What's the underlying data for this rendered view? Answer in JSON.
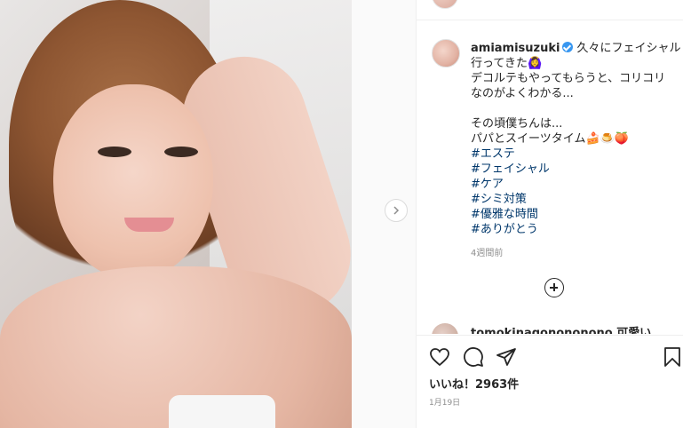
{
  "post": {
    "username": "amiamisuzuki",
    "caption_lines": [
      "久々にフェイシャル",
      "行ってきた🙆‍♀️",
      "デコルテもやってもらうと、コリコリ",
      "なのがよくわかる...",
      "",
      "その頃僕ちんは...",
      "パパとスイーツタイム🍰🍮🍑"
    ],
    "hashtags": [
      "#エステ",
      "#フェイシャル",
      "#ケア",
      "#シミ対策",
      "#優雅な時間",
      "#ありがとう"
    ],
    "timestamp": "4週間前",
    "next_comment": "tomokinagonononono 可愛い",
    "likes_label": "いいね！2963件",
    "date": "1月19日"
  },
  "icons": {
    "next": "chevron-right-icon",
    "load_more": "plus-circle-icon",
    "like": "heart-icon",
    "comment": "comment-icon",
    "share": "paper-plane-icon",
    "save": "bookmark-icon",
    "verified": "verified-badge-icon"
  },
  "colors": {
    "verified": "#3897f0",
    "hashtag": "#00376b",
    "muted": "#8e8e8e"
  }
}
